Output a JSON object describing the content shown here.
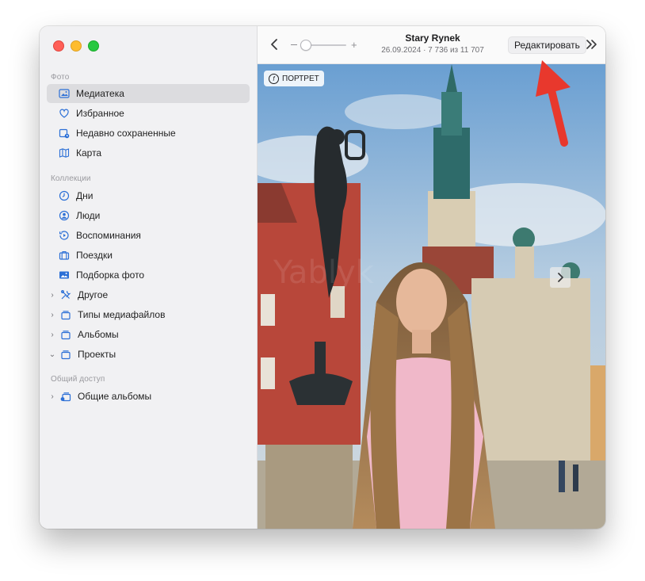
{
  "sidebar": {
    "sections": {
      "photos": "Фото",
      "collections": "Коллекции",
      "shared": "Общий доступ"
    },
    "items": [
      {
        "label": "Медиатека",
        "icon": "library-icon",
        "selected": true
      },
      {
        "label": "Избранное",
        "icon": "heart-icon"
      },
      {
        "label": "Недавно сохраненные",
        "icon": "recently-saved-icon"
      },
      {
        "label": "Карта",
        "icon": "map-icon"
      },
      {
        "label": "Дни",
        "icon": "clock-icon"
      },
      {
        "label": "Люди",
        "icon": "person-icon"
      },
      {
        "label": "Воспоминания",
        "icon": "memories-icon"
      },
      {
        "label": "Поездки",
        "icon": "suitcase-icon"
      },
      {
        "label": "Подборка фото",
        "icon": "photo-icon"
      },
      {
        "label": "Другое",
        "icon": "tools-icon",
        "chevron": "right"
      },
      {
        "label": "Типы медиафайлов",
        "icon": "stack-icon",
        "chevron": "right"
      },
      {
        "label": "Альбомы",
        "icon": "stack-icon",
        "chevron": "right"
      },
      {
        "label": "Проекты",
        "icon": "stack-icon",
        "chevron": "down"
      },
      {
        "label": "Общие альбомы",
        "icon": "shared-albums-icon",
        "chevron": "right"
      }
    ]
  },
  "toolbar": {
    "title": "Stary Rynek",
    "date": "26.09.2024",
    "counter": "7 736 из 11 707",
    "edit_label": "Редактировать",
    "zoom_plus": "+"
  },
  "photo": {
    "badge": "ПОРТРЕТ",
    "badge_icon": "f",
    "watermark": "Yablyk"
  },
  "colors": {
    "accent": "#2b6fd6",
    "annotation_arrow": "#e8382d"
  }
}
